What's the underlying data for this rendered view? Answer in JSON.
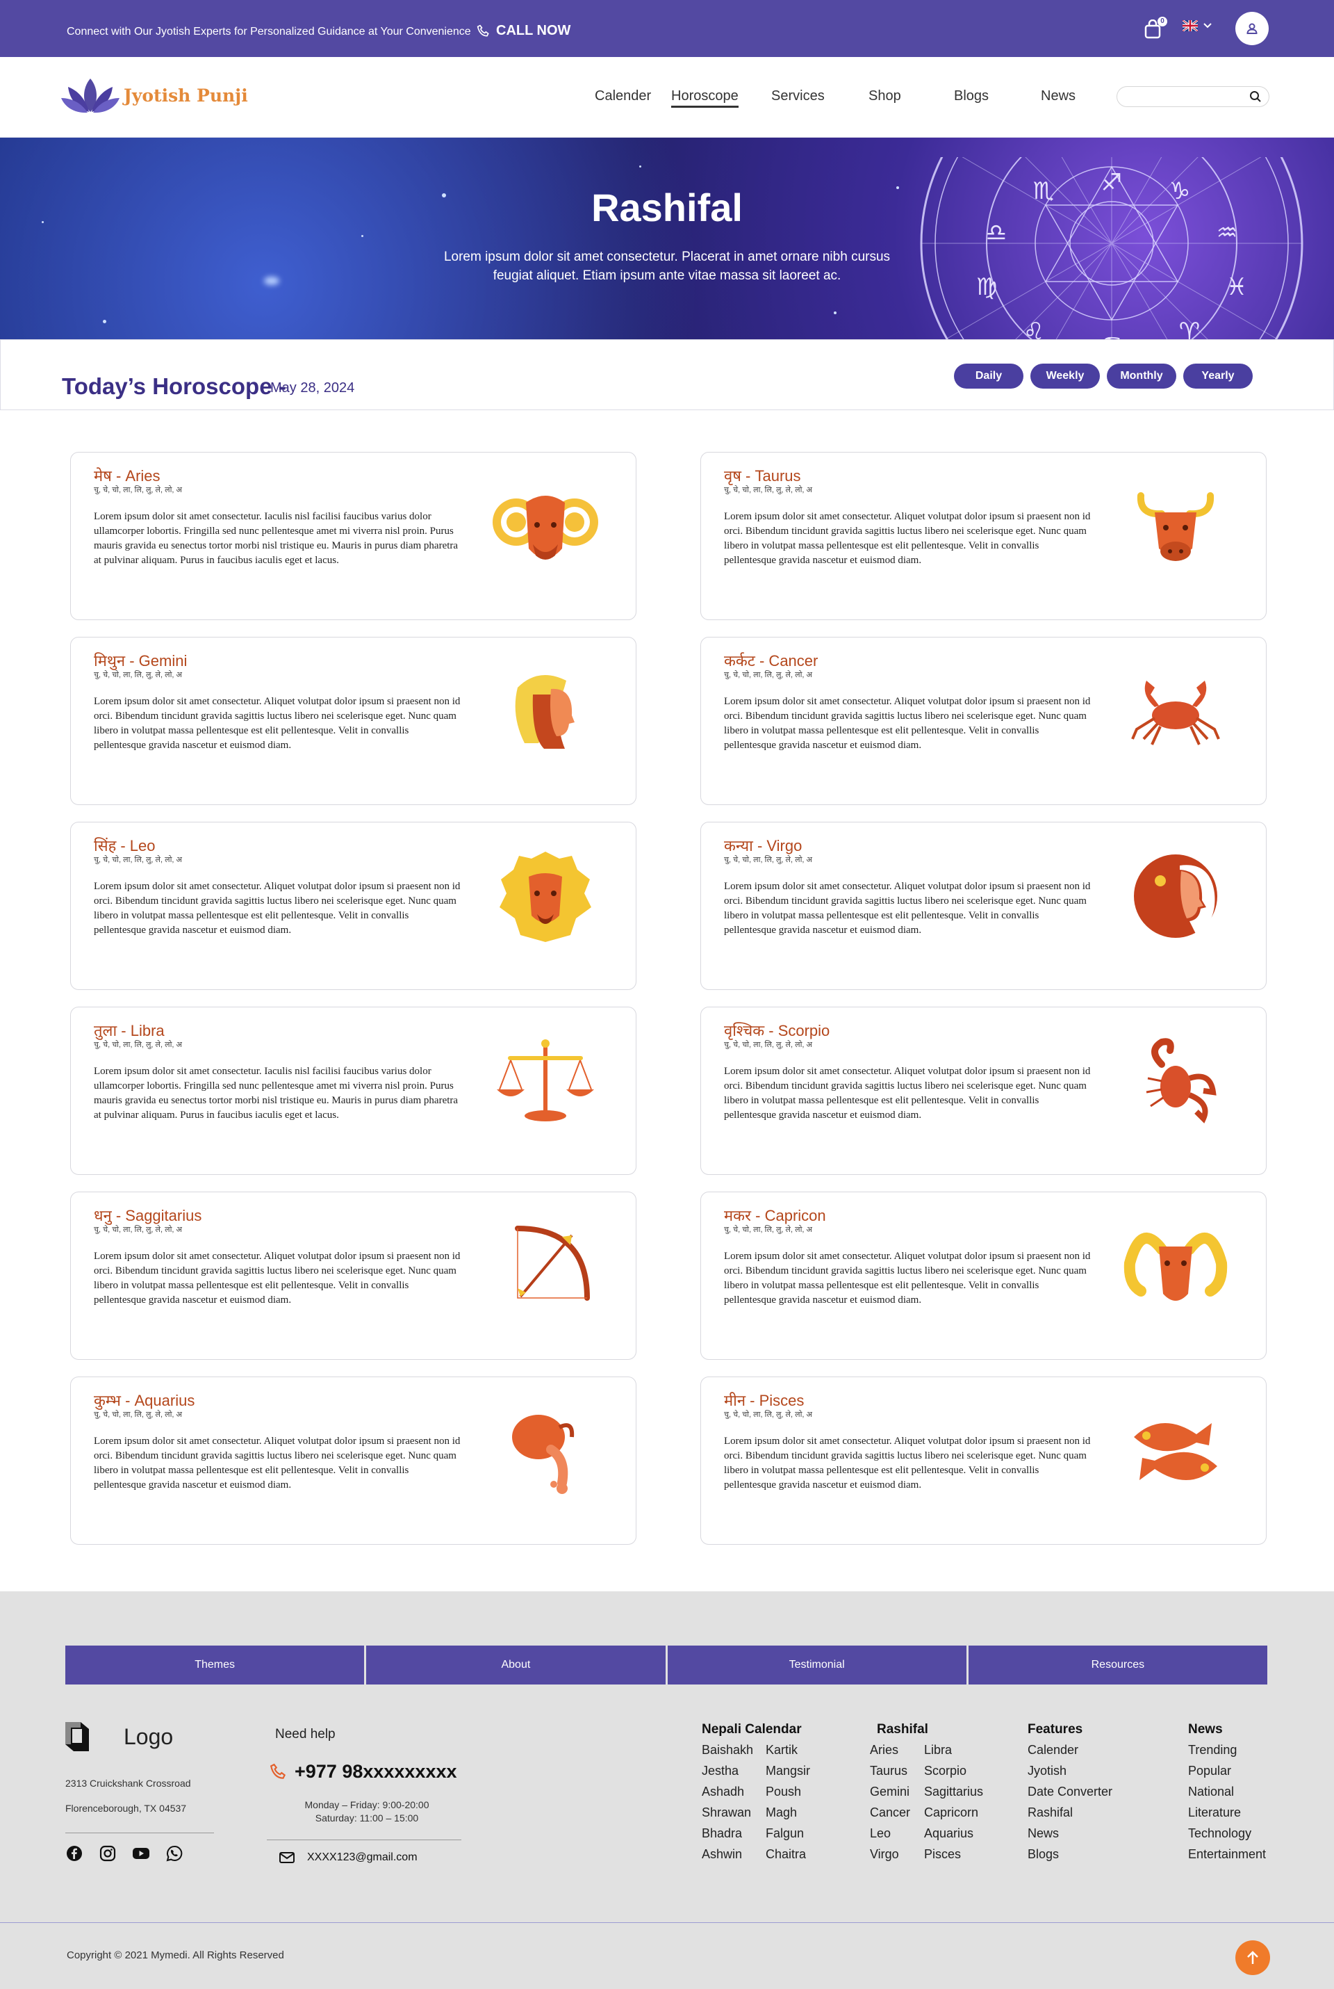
{
  "topbar": {
    "promo": "Connect with Our Jyotish Experts for Personalized Guidance at Your Convenience",
    "call_label": "CALL NOW",
    "cart_count": "0"
  },
  "nav": {
    "logo_text": "Jyotish Punji",
    "items": [
      "Calender",
      "Horoscope",
      "Services",
      "Shop",
      "Blogs",
      "News"
    ],
    "active": "Horoscope",
    "search_placeholder": ""
  },
  "hero": {
    "title": "Rashifal",
    "text": "Lorem ipsum dolor sit amet consectetur. Placerat in amet ornare nibh cursus feugiat aliquet. Etiam ipsum ante vitae massa sit laoreet ac."
  },
  "horoscope": {
    "title": "Today’s Horoscope -",
    "date": "May 28, 2024",
    "tabs": [
      "Daily",
      "Weekly",
      "Monthly",
      "Yearly"
    ],
    "signs": [
      {
        "title": "मेष - Aries",
        "syllables": "चु, चे, चो, ला, लि, लु, ले, लो, अ",
        "text": "Lorem ipsum dolor sit amet consectetur. Iaculis nisl facilisi faucibus varius dolor ullamcorper lobortis. Fringilla sed nunc pellentesque amet mi viverra nisl proin. Purus mauris gravida eu senectus tortor morbi nisl tristique eu. Mauris in purus diam pharetra at pulvinar aliquam. Purus in faucibus iaculis eget et lacus.",
        "icon": "aries-ram-icon"
      },
      {
        "title": "वृष - Taurus",
        "syllables": "चु, चे, चो, ला, लि, लु, ले, लो, अ",
        "text": "Lorem ipsum dolor sit amet consectetur. Aliquet volutpat dolor ipsum si praesent non id orci. Bibendum tincidunt gravida sagittis luctus libero nei scelerisque eget. Nunc quam libero in volutpat massa pellentesque est elit pellentesque. Velit in convallis pellentesque gravida nascetur et euismod diam.",
        "icon": "taurus-bull-icon"
      },
      {
        "title": "मिथुन - Gemini",
        "syllables": "चु, चे, चो, ला, लि, लु, ले, लो, अ",
        "text": "Lorem ipsum dolor sit amet consectetur. Aliquet volutpat dolor ipsum si praesent non id orci. Bibendum tincidunt gravida sagittis luctus libero nei scelerisque eget. Nunc quam libero in volutpat massa pellentesque est elit pellentesque. Velit in convallis pellentesque gravida nascetur et euismod diam.",
        "icon": "gemini-twins-icon"
      },
      {
        "title": "कर्कट - Cancer",
        "syllables": "चु, चे, चो, ला, लि, लु, ले, लो, अ",
        "text": "Lorem ipsum dolor sit amet consectetur. Aliquet volutpat dolor ipsum si praesent non id orci. Bibendum tincidunt gravida sagittis luctus libero nei scelerisque eget. Nunc quam libero in volutpat massa pellentesque est elit pellentesque. Velit in convallis pellentesque gravida nascetur et euismod diam.",
        "icon": "cancer-crab-icon"
      },
      {
        "title": "सिंह - Leo",
        "syllables": "चु, चे, चो, ला, लि, लु, ले, लो, अ",
        "text": "Lorem ipsum dolor sit amet consectetur. Aliquet volutpat dolor ipsum si praesent non id orci. Bibendum tincidunt gravida sagittis luctus libero nei scelerisque eget. Nunc quam libero in volutpat massa pellentesque est elit pellentesque. Velit in convallis pellentesque gravida nascetur et euismod diam.",
        "icon": "leo-lion-icon"
      },
      {
        "title": "कन्या - Virgo",
        "syllables": "चु, चे, चो, ला, लि, लु, ले, लो, अ",
        "text": "Lorem ipsum dolor sit amet consectetur. Aliquet volutpat dolor ipsum si praesent non id orci. Bibendum tincidunt gravida sagittis luctus libero nei scelerisque eget. Nunc quam libero in volutpat massa pellentesque est elit pellentesque. Velit in convallis pellentesque gravida nascetur et euismod diam.",
        "icon": "virgo-maiden-icon"
      },
      {
        "title": "तुला - Libra",
        "syllables": "चु, चे, चो, ला, लि, लु, ले, लो, अ",
        "text": "Lorem ipsum dolor sit amet consectetur. Iaculis nisl facilisi faucibus varius dolor ullamcorper lobortis. Fringilla sed nunc pellentesque amet mi viverra nisl proin. Purus mauris gravida eu senectus tortor morbi nisl tristique eu. Mauris in purus diam pharetra at pulvinar aliquam. Purus in faucibus iaculis eget et lacus.",
        "icon": "libra-scales-icon"
      },
      {
        "title": "वृश्चिक - Scorpio",
        "syllables": "चु, चे, चो, ला, लि, लु, ले, लो, अ",
        "text": "Lorem ipsum dolor sit amet consectetur. Aliquet volutpat dolor ipsum si praesent non id orci. Bibendum tincidunt gravida sagittis luctus libero nei scelerisque eget. Nunc quam libero in volutpat massa pellentesque est elit pellentesque. Velit in convallis pellentesque gravida nascetur et euismod diam.",
        "icon": "scorpio-scorpion-icon"
      },
      {
        "title": "धनु - Saggitarius",
        "syllables": "चु, चे, चो, ला, लि, लु, ले, लो, अ",
        "text": "Lorem ipsum dolor sit amet consectetur. Aliquet volutpat dolor ipsum si praesent non id orci. Bibendum tincidunt gravida sagittis luctus libero nei scelerisque eget. Nunc quam libero in volutpat massa pellentesque est elit pellentesque. Velit in convallis pellentesque gravida nascetur et euismod diam.",
        "icon": "sagittarius-bow-icon"
      },
      {
        "title": "मकर - Capricon",
        "syllables": "चु, चे, चो, ला, लि, लु, ले, लो, अ",
        "text": "Lorem ipsum dolor sit amet consectetur. Aliquet volutpat dolor ipsum si praesent non id orci. Bibendum tincidunt gravida sagittis luctus libero nei scelerisque eget. Nunc quam libero in volutpat massa pellentesque est elit pellentesque. Velit in convallis pellentesque gravida nascetur et euismod diam.",
        "icon": "capricorn-goat-icon"
      },
      {
        "title": "कुम्भ - Aquarius",
        "syllables": "चु, चे, चो, ला, लि, लु, ले, लो, अ",
        "text": "Lorem ipsum dolor sit amet consectetur. Aliquet volutpat dolor ipsum si praesent non id orci. Bibendum tincidunt gravida sagittis luctus libero nei scelerisque eget. Nunc quam libero in volutpat massa pellentesque est elit pellentesque. Velit in convallis pellentesque gravida nascetur et euismod diam.",
        "icon": "aquarius-pot-icon"
      },
      {
        "title": "मीन - Pisces",
        "syllables": "चु, चे, चो, ला, लि, लु, ले, लो, अ",
        "text": "Lorem ipsum dolor sit amet consectetur. Aliquet volutpat dolor ipsum si praesent non id orci. Bibendum tincidunt gravida sagittis luctus libero nei scelerisque eget. Nunc quam libero in volutpat massa pellentesque est elit pellentesque. Velit in convallis pellentesque gravida nascetur et euismod diam.",
        "icon": "pisces-fish-icon"
      }
    ]
  },
  "footer": {
    "tabs": [
      "Themes",
      "About",
      "Testimonial",
      "Resources"
    ],
    "logo_text": "Logo",
    "address_line1": "2313 Cruickshank Crossroad",
    "address_line2": "Florenceborough, TX 04537",
    "help_title": "Need help",
    "phone": "+977 98xxxxxxxxx",
    "hours_line1": "Monday – Friday: 9:00-20:00",
    "hours_line2": "Saturday: 11:00 – 15:00",
    "email": "XXXX123@gmail.com",
    "columns": {
      "nepali_calendar": {
        "title": "Nepali Calendar",
        "col1": [
          "Baishakh",
          "Jestha",
          "Ashadh",
          "Shrawan",
          "Bhadra",
          "Ashwin"
        ],
        "col2": [
          "Kartik",
          "Mangsir",
          "Poush",
          "Magh",
          "Falgun",
          "Chaitra"
        ]
      },
      "rashifal": {
        "title": "Rashifal",
        "col1": [
          "Aries",
          "Taurus",
          "Gemini",
          "Cancer",
          "Leo",
          "Virgo"
        ],
        "col2": [
          "Libra",
          "Scorpio",
          "Sagittarius",
          "Capricorn",
          "Aquarius",
          "Pisces"
        ]
      },
      "features": {
        "title": "Features",
        "items": [
          "Calender",
          "Jyotish",
          "Date Converter",
          "Rashifal",
          "News",
          "Blogs"
        ]
      },
      "news": {
        "title": "News",
        "items": [
          "Trending",
          "Popular",
          "National",
          "Literature",
          "Technology",
          "Entertainment"
        ]
      }
    },
    "copyright": "Copyright © 2021 Mymedi. All Rights Reserved"
  },
  "colors": {
    "primary": "#5349a2",
    "accent_orange": "#f07b2a",
    "sign_title": "#b4471c",
    "heading": "#3b2f85"
  }
}
